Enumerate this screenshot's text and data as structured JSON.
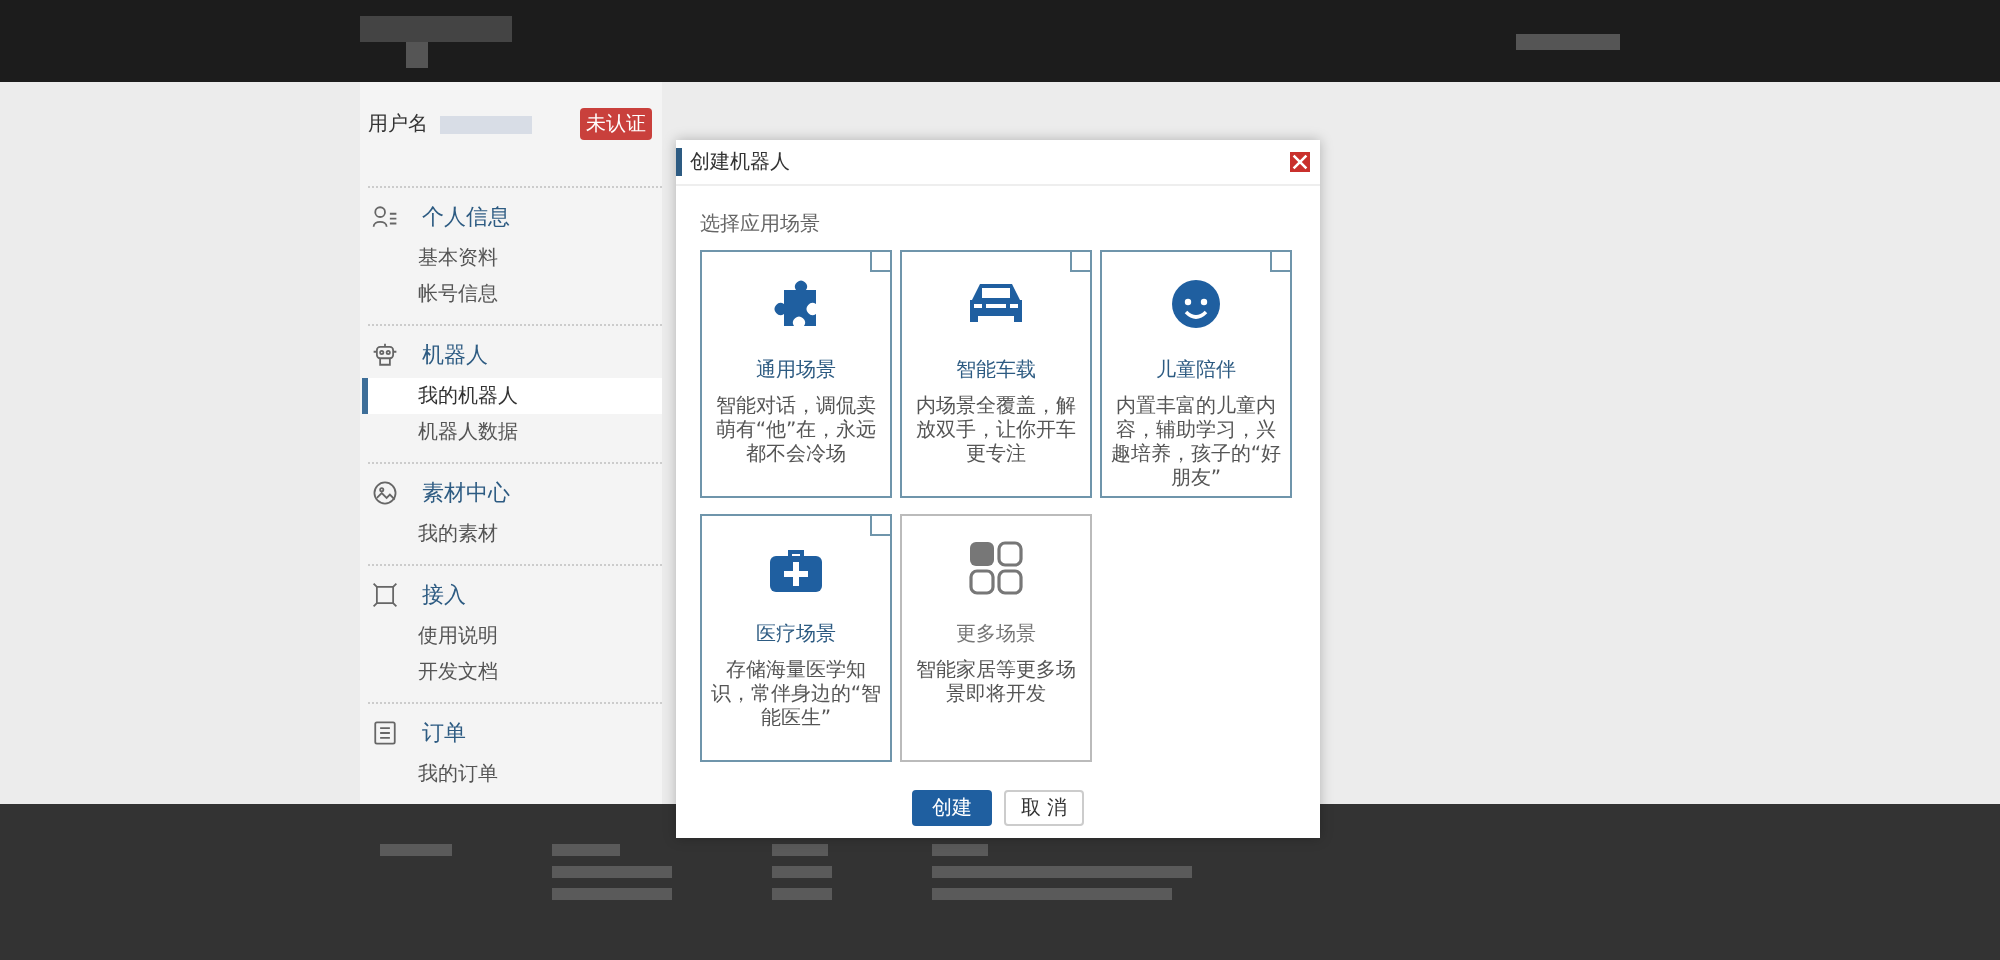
{
  "sidebar": {
    "username_label": "用户名",
    "badge": "未认证",
    "sections": [
      {
        "title": "个人信息",
        "items": [
          {
            "label": "基本资料",
            "selected": false
          },
          {
            "label": "帐号信息",
            "selected": false
          }
        ]
      },
      {
        "title": "机器人",
        "items": [
          {
            "label": "我的机器人",
            "selected": true
          },
          {
            "label": "机器人数据",
            "selected": false
          }
        ]
      },
      {
        "title": "素材中心",
        "items": [
          {
            "label": "我的素材",
            "selected": false
          }
        ]
      },
      {
        "title": "接入",
        "items": [
          {
            "label": "使用说明",
            "selected": false
          },
          {
            "label": "开发文档",
            "selected": false
          }
        ]
      },
      {
        "title": "订单",
        "items": [
          {
            "label": "我的订单",
            "selected": false
          }
        ]
      }
    ]
  },
  "dialog": {
    "title": "创建机器人",
    "prompt": "选择应用场景",
    "scenes": [
      {
        "title": "通用场景",
        "description": "智能对话，调侃卖萌有“他”在，永远都不会冷场",
        "disabled": false
      },
      {
        "title": "智能车载",
        "description": "内场景全覆盖，解放双手，让你开车更专注",
        "disabled": false
      },
      {
        "title": "儿童陪伴",
        "description": "内置丰富的儿童内容，辅助学习，兴趣培养，孩子的“好朋友”",
        "disabled": false
      },
      {
        "title": "医疗场景",
        "description": "存储海量医学知识，常伴身边的“智能医生”",
        "disabled": false
      },
      {
        "title": "更多场景",
        "description": "智能家居等更多场景即将开发",
        "disabled": true
      }
    ],
    "buttons": [
      {
        "label": "创建",
        "kind": "primary"
      },
      {
        "label": "取 消",
        "kind": "secondary"
      }
    ]
  }
}
